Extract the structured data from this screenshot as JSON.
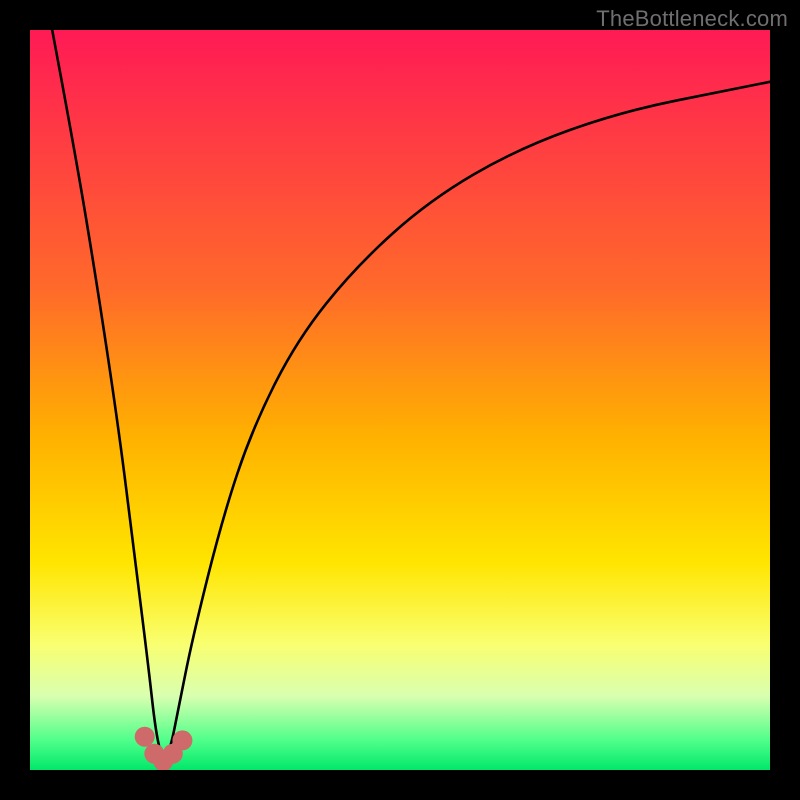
{
  "watermark": "TheBottleneck.com",
  "chart_data": {
    "type": "line",
    "title": "",
    "xlabel": "",
    "ylabel": "",
    "xlim": [
      0,
      100
    ],
    "ylim": [
      0,
      100
    ],
    "grid": false,
    "legend": false,
    "x_optimum": 18,
    "gradient_stops": [
      {
        "pct": 0,
        "color": "#ff1a55"
      },
      {
        "pct": 35,
        "color": "#ff6a2a"
      },
      {
        "pct": 55,
        "color": "#ffb100"
      },
      {
        "pct": 72,
        "color": "#ffe500"
      },
      {
        "pct": 83,
        "color": "#f9ff70"
      },
      {
        "pct": 90,
        "color": "#d9ffb0"
      },
      {
        "pct": 96,
        "color": "#4fff8a"
      },
      {
        "pct": 100,
        "color": "#00e86a"
      }
    ],
    "series": [
      {
        "name": "bottleneck-curve",
        "note": "V-shaped curve; values approximate heights read from gradient, 0=bottom green band, 100=top red",
        "x": [
          3,
          6,
          9,
          12,
          14,
          16,
          17,
          18,
          19,
          20,
          22,
          26,
          30,
          36,
          44,
          54,
          66,
          80,
          95,
          100
        ],
        "values": [
          100,
          84,
          66,
          46,
          30,
          14,
          5,
          1,
          3,
          8,
          18,
          34,
          46,
          58,
          68,
          77,
          84,
          89,
          92,
          93
        ]
      }
    ],
    "markers": {
      "name": "valley-dots",
      "color": "#cf6a6a",
      "radius": 10,
      "points": [
        {
          "x": 15.5,
          "y": 4.5
        },
        {
          "x": 16.8,
          "y": 2.2
        },
        {
          "x": 18.0,
          "y": 1.2
        },
        {
          "x": 19.3,
          "y": 2.2
        },
        {
          "x": 20.6,
          "y": 4.0
        }
      ]
    }
  }
}
